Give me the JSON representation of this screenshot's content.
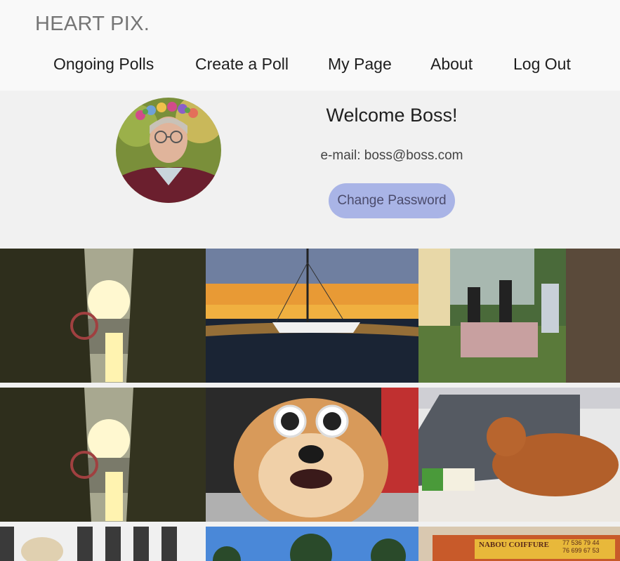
{
  "header": {
    "brand": "HEART PIX.",
    "nav": [
      {
        "label": "Ongoing Polls"
      },
      {
        "label": "Create a Poll"
      },
      {
        "label": "My Page"
      },
      {
        "label": "About"
      },
      {
        "label": "Log Out"
      }
    ]
  },
  "profile": {
    "welcome": "Welcome Boss!",
    "email": "e-mail: boss@boss.com",
    "change_password_label": "Change Password",
    "accent_color": "#a9b4e6"
  },
  "gallery": {
    "photos": [
      {
        "subject": "sunset over lake through trees"
      },
      {
        "subject": "sailboat at sunset"
      },
      {
        "subject": "people at garden table"
      },
      {
        "subject": "sunset over lake through trees"
      },
      {
        "subject": "fluffy dog with sunglasses"
      },
      {
        "subject": "golden retriever lying on floor"
      },
      {
        "subject": "dog by striped fence"
      },
      {
        "subject": "trees under blue sky"
      },
      {
        "subject": "storefront sign"
      }
    ],
    "sign_text": "NABOU COIFFURE",
    "sign_phone_1": "77 536 79 44",
    "sign_phone_2": "76 699 67 53"
  }
}
